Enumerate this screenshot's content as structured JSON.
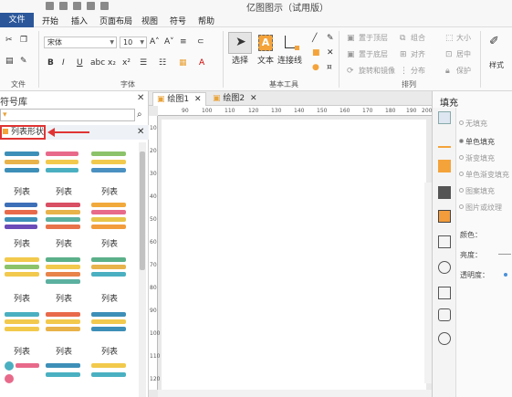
{
  "app": {
    "title": "亿图图示（试用版）"
  },
  "menu": {
    "file": "文件",
    "items": [
      "开始",
      "插入",
      "页面布局",
      "视图",
      "符号",
      "帮助"
    ]
  },
  "ribbon": {
    "font_name": "宋体",
    "font_size": "10",
    "groups": {
      "file": "文件",
      "font": "字体",
      "basic_tools": "基本工具",
      "arrange": "排列"
    },
    "tools": {
      "select": "选择",
      "text": "文本",
      "connector": "连接线"
    },
    "arrange": {
      "top": "置于顶层",
      "bottom": "置于底层",
      "rotate": "旋转和镜像",
      "group": "组合",
      "align": "对齐",
      "distribute": "分布",
      "size": "大小",
      "center": "居中",
      "protect": "保护"
    },
    "style": "样式"
  },
  "library": {
    "title": "符号库",
    "category": "列表形状",
    "items": [
      "列表",
      "列表",
      "列表",
      "列表",
      "列表",
      "列表",
      "列表",
      "列表",
      "列表",
      "列表",
      "列表",
      "列表"
    ]
  },
  "tabs": [
    "绘图1",
    "绘图2"
  ],
  "ruler": [
    "90",
    "100",
    "110",
    "120",
    "130",
    "140",
    "150",
    "160",
    "170",
    "180",
    "190",
    "200"
  ],
  "ruler_v": [
    "10",
    "20",
    "30",
    "40",
    "50",
    "60",
    "70",
    "80",
    "90",
    "100",
    "110",
    "120"
  ],
  "fill": {
    "title": "填充",
    "options": [
      "无填充",
      "单色填充",
      "渐变填充",
      "单色渐变填充",
      "图案填充",
      "图片或纹理"
    ],
    "color_label": "颜色：",
    "brightness_label": "亮度：",
    "transparency_label": "透明度："
  },
  "colors": {
    "accent": "#2b579a",
    "highlight": "#e03434",
    "orange": "#f4a33a"
  }
}
